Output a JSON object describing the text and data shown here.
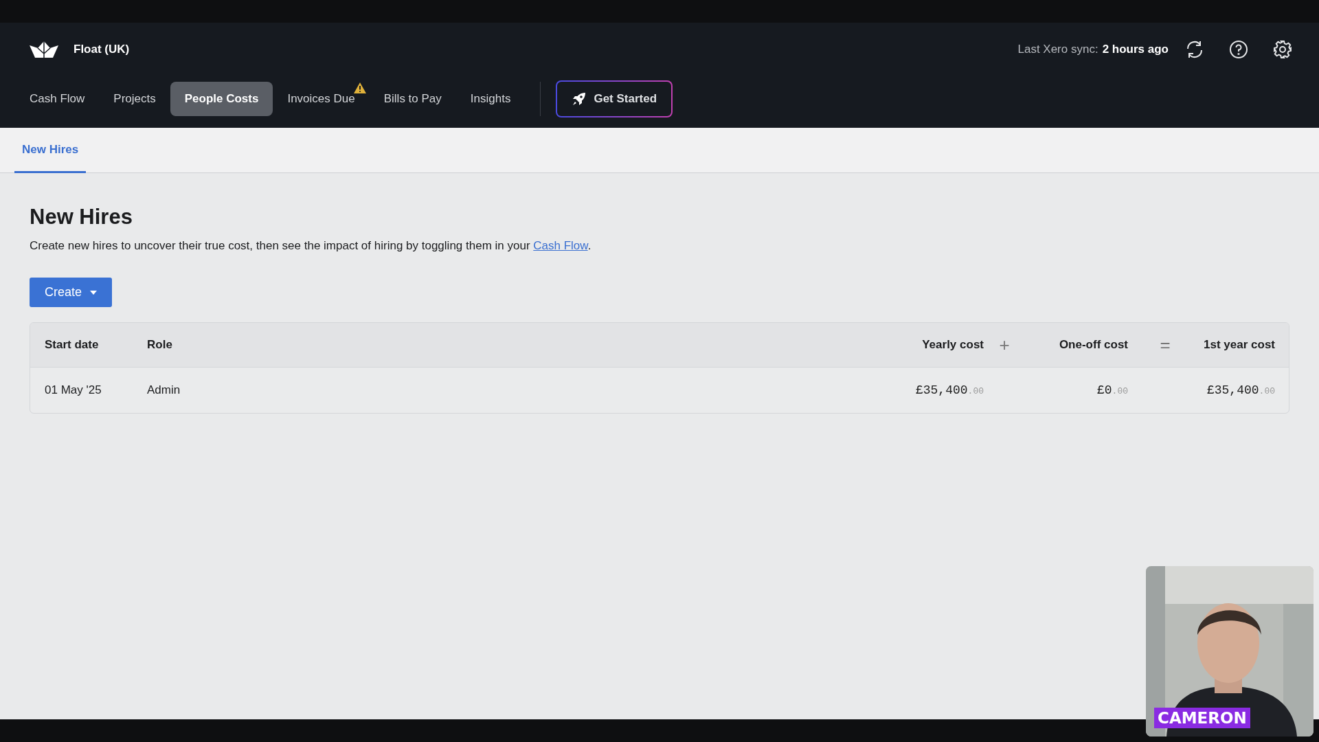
{
  "header": {
    "company": "Float (UK)",
    "sync_label": "Last Xero sync:",
    "sync_time": "2 hours ago"
  },
  "nav": [
    {
      "label": "Cash Flow",
      "selected": false,
      "warning": false
    },
    {
      "label": "Projects",
      "selected": false,
      "warning": false
    },
    {
      "label": "People Costs",
      "selected": true,
      "warning": false
    },
    {
      "label": "Invoices Due",
      "selected": false,
      "warning": true
    },
    {
      "label": "Bills to Pay",
      "selected": false,
      "warning": false
    },
    {
      "label": "Insights",
      "selected": false,
      "warning": false
    }
  ],
  "get_started": "Get Started",
  "subtabs": [
    {
      "label": "New Hires",
      "selected": true
    }
  ],
  "page": {
    "title": "New Hires",
    "description": "Create new hires to uncover their true cost, then see the impact of hiring by toggling them in your ",
    "link": "Cash Flow",
    "description_end": ".",
    "create_button": "Create"
  },
  "table": {
    "columns": [
      {
        "kind": "text",
        "label": "Start date"
      },
      {
        "kind": "text",
        "label": "Role"
      },
      {
        "kind": "text",
        "label": "Yearly cost"
      },
      {
        "kind": "operator",
        "label": "+"
      },
      {
        "kind": "text",
        "label": "One-off cost"
      },
      {
        "kind": "operator",
        "label": "="
      },
      {
        "kind": "text",
        "label": "1st year cost"
      }
    ],
    "rows": [
      {
        "start_date": "01 May '25",
        "role": "Admin",
        "yearly_cost": {
          "main": "£35,400",
          "cents": ".00"
        },
        "one_off_cost": {
          "main": "£0",
          "cents": ".00"
        },
        "first_year_cost": {
          "main": "£35,400",
          "cents": ".00"
        }
      }
    ]
  },
  "video": {
    "kind": "picture",
    "name_label": "CAMERON"
  }
}
